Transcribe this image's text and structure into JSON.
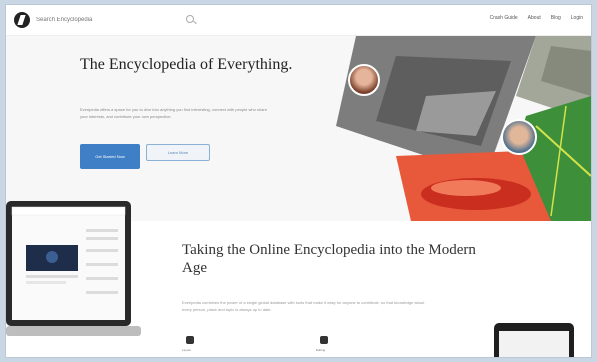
{
  "nav": {
    "search_placeholder": "Search Encyclopedia",
    "links": [
      "Crash Guide",
      "About",
      "Blog",
      "Login"
    ]
  },
  "hero": {
    "title": "The Encyclopedia of Everything.",
    "description": "Everipedia offers a space for you to dive into anything you find interesting, connect with people who share your interests, and contribute your own perspective.",
    "primary_button": "Get Started Now",
    "secondary_button": "Learn More"
  },
  "section": {
    "title": "Taking the Online Encyclopedia into the Modern Age",
    "description": "Everipedia combines the power of a single global database with tools that make it easy for anyone to contribute, so that knowledge about every person, place and topic is always up to date."
  },
  "features": [
    "Layout",
    "Editing"
  ],
  "colors": {
    "accent": "#3f7fc6",
    "hero_bg": "#f7f7f7",
    "frame": "#c9d6e3"
  }
}
